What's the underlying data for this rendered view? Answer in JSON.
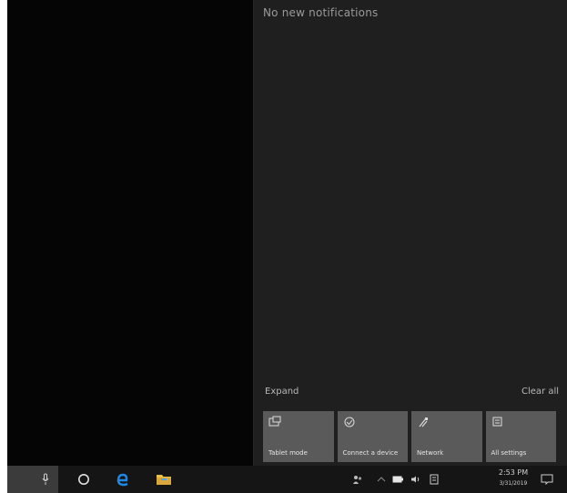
{
  "action_center": {
    "heading": "No new notifications",
    "collapse_label": "Expand",
    "clear_label": "Clear all",
    "tiles": [
      {
        "label": "Tablet mode",
        "icon": "tablet-mode-icon"
      },
      {
        "label": "Connect a device",
        "icon": "connect-icon"
      },
      {
        "label": "Network",
        "icon": "network-icon"
      },
      {
        "label": "All settings",
        "icon": "settings-icon"
      }
    ]
  },
  "taskbar": {
    "pinned": [
      "microphone-icon",
      "task-view-icon",
      "edge-browser-icon",
      "file-explorer-icon"
    ],
    "tray": [
      "people-icon",
      "show-hidden-icons-chevron",
      "battery-icon",
      "volume-icon",
      "keyboard-icon"
    ],
    "clock_time": "2:53 PM",
    "clock_date": "3/31/2019"
  },
  "colors": {
    "desktop": "#050505",
    "panel": "#1f1f1f",
    "tile": "#5a5a5a",
    "taskbar": "#151515",
    "edge_blue": "#1e88e5",
    "folder_yellow": "#e8c04a"
  }
}
